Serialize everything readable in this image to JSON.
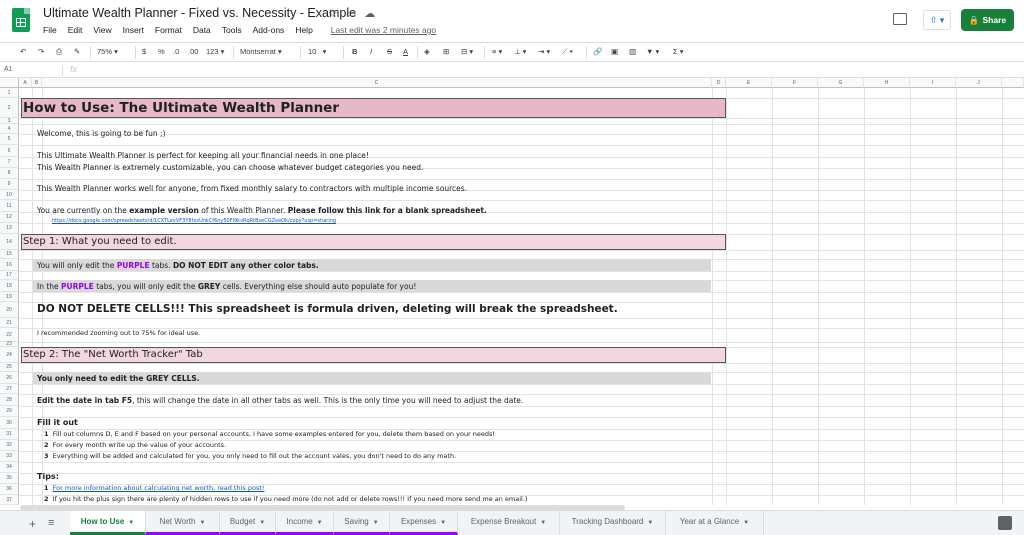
{
  "app": {
    "title": "Ultimate Wealth Planner - Fixed vs. Necessity - Example",
    "last_edit": "Last edit was 2 minutes ago",
    "share_label": "Share"
  },
  "menu": [
    "File",
    "Edit",
    "View",
    "Insert",
    "Format",
    "Data",
    "Tools",
    "Add-ons",
    "Help"
  ],
  "toolbar": {
    "zoom": "75%",
    "currency": "$",
    "percent": "%",
    "decimal_dec": ".0",
    "decimal_inc": ".00",
    "more_formats": "123",
    "font": "Montserrat",
    "font_size": "10",
    "bold": "B",
    "italic": "I",
    "strike": "S",
    "text_color": "A",
    "sum": "Σ"
  },
  "formula_bar": {
    "cell_ref": "A1",
    "fx": "fx"
  },
  "columns": [
    "A",
    "B",
    "C",
    "D",
    "E",
    "F",
    "G",
    "H",
    "I",
    "J"
  ],
  "rows": [
    "1",
    "2",
    "3",
    "4",
    "5",
    "6",
    "7",
    "8",
    "9",
    "10",
    "11",
    "12",
    "13",
    "14",
    "15",
    "16",
    "17",
    "18",
    "19",
    "20",
    "21",
    "22",
    "23",
    "24",
    "25",
    "26",
    "27",
    "28",
    "29",
    "30",
    "31",
    "32",
    "33",
    "34",
    "35",
    "36",
    "37"
  ],
  "content": {
    "h1": "How to Use: The Ultimate Wealth Planner",
    "welcome": "Welcome, this is going to be fun ;)",
    "p1": "This Ultimate Wealth Planner is perfect for keeping all your financial needs in one place!",
    "p2": "This Wealth Planner is extremely customizable, you can choose whatever budget categories you need.",
    "p3": "This Wealth Planner works well for anyone, from fixed monthly salary to contractors with multiple income sources.",
    "p4_a": "You are currently on the ",
    "p4_b": "example version",
    "p4_c": " of this Wealth Planner. ",
    "p4_d": "Please follow this link for a blank spreadsheet.",
    "link": "https://docs.google.com/spreadsheets/d/1CXTLevVF3Y8txsUnkCf6ny50Fl9kvRqRtBseCGZeeOk/copy?usp=sharing",
    "step1": "Step 1: What you need to edit.",
    "s1a_a": "You will only edit the ",
    "s1a_b": "PURPLE",
    "s1a_c": " tabs. ",
    "s1a_d": "DO NOT EDIT any other color tabs.",
    "s1b_a": "In the ",
    "s1b_b": "PURPLE",
    "s1b_c": " tabs, you will only edit the ",
    "s1b_d": "GREY",
    "s1b_e": " cells. Everything else should auto populate for you!",
    "warn": "DO NOT DELETE CELLS!!! This spreadsheet is formula driven, deleting will break the spreadsheet.",
    "zoom_note": "I recommended zooming out to 75% for ideal use.",
    "step2": "Step 2: The \"Net Worth Tracker\" Tab",
    "s2a": "You only need to edit the GREY CELLS.",
    "s2b_a": "Edit the date in tab F5",
    "s2b_b": ", this will change the date in all other tabs as well. This is the only time you will need to adjust the date.",
    "fill": "Fill it out",
    "f1n": "1",
    "f1": "Fill out columns D, E and F based on your personal accounts, I have some examples entered for you, delete them based on your needs!",
    "f2n": "2",
    "f2": "For every month write up the value of your accounts.",
    "f3n": "3",
    "f3": "Everything will be added and calculated for you, you only need to fill out the account vales, you don't need to do any math.",
    "tips": "Tips:",
    "t1n": "1",
    "t1": "For more information about calculating net worth, read this post!",
    "t2n": "2",
    "t2": "If you hit the plus sign there are plenty of hidden rows to use if you need more (do not add or delete rows!!! If you need more send me an email.)"
  },
  "tabs": [
    {
      "label": "How to Use",
      "active": true,
      "color": "#188038"
    },
    {
      "label": "Net Worth",
      "color": "#9900ff"
    },
    {
      "label": "Budget",
      "color": "#9900ff"
    },
    {
      "label": "Income",
      "color": "#9900ff"
    },
    {
      "label": "Saving",
      "color": "#9900ff"
    },
    {
      "label": "Expenses",
      "color": "#9900ff"
    },
    {
      "label": "Expense Breakout"
    },
    {
      "label": "Tracking Dashboard"
    },
    {
      "label": "Year at a Glance"
    }
  ],
  "colors": {
    "header_fill": "#e6b8c8",
    "step_fill": "#f2d7df",
    "grey_fill": "#d9d9d9",
    "purple_text": "#9900ff",
    "share_green": "#188038"
  }
}
